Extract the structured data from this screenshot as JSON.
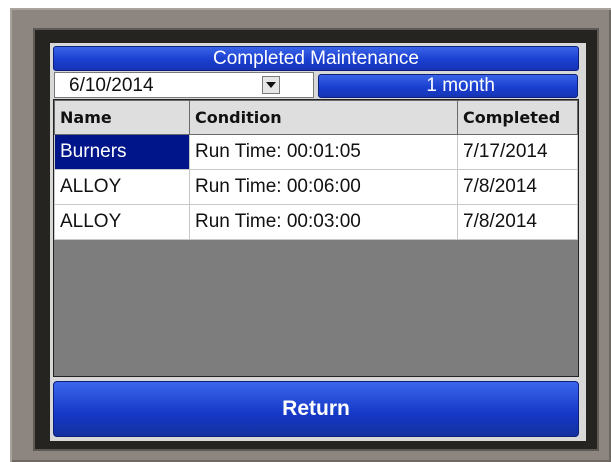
{
  "header": {
    "title": "Completed Maintenance"
  },
  "filter": {
    "date": "6/10/2014",
    "range": "1 month"
  },
  "table": {
    "columns": [
      "Name",
      "Condition",
      "Completed"
    ],
    "rows": [
      [
        "Burners",
        "Run Time: 00:01:05",
        "7/17/2014"
      ],
      [
        "ALLOY",
        "Run Time: 00:06:00",
        "7/8/2014"
      ],
      [
        "ALLOY",
        "Run Time: 00:03:00",
        "7/8/2014"
      ]
    ],
    "selected_row": 0
  },
  "footer": {
    "return_label": "Return"
  },
  "icons": {
    "dropdown": "chevron-down-icon"
  },
  "colors": {
    "accent": "#1a3fd0",
    "selection": "#00158a"
  }
}
